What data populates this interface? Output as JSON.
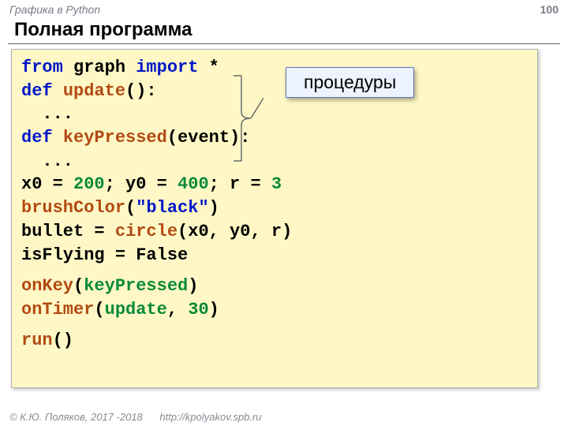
{
  "header": {
    "topic": "Графика в Python",
    "slideNumber": "100"
  },
  "title": "Полная программа",
  "callout": "процедуры",
  "code": {
    "l1a": "from",
    "l1b": "graph",
    "l1c": "import",
    "l1d": "*",
    "l2a": "def",
    "l2b": "update",
    "l2c": "():",
    "l3": "  ...",
    "l4a": "def",
    "l4b": "keyPressed",
    "l4c": "(event):",
    "l5": "  ...",
    "l6a": "x0 = ",
    "l6b": "200",
    "l6c": "; y0 = ",
    "l6d": "400",
    "l6e": "; r = ",
    "l6f": "3",
    "l7a": "brushColor",
    "l7b": "(",
    "l7c": "\"black\"",
    "l7d": ")",
    "l8a": "bullet = ",
    "l8b": "circle",
    "l8c": "(x0, y0, r)",
    "l9": "isFlying = False",
    "l10a": "onKey",
    "l10b": "(",
    "l10c": "keyPressed",
    "l10d": ")",
    "l11a": "onTimer",
    "l11b": "(",
    "l11c": "update",
    "l11d": ", ",
    "l11e": "30",
    "l11f": ")",
    "l12a": "run",
    "l12b": "()"
  },
  "footer": {
    "copyright": "© К.Ю. Поляков, 2017 -2018",
    "url": "http://kpolyakov.spb.ru"
  }
}
